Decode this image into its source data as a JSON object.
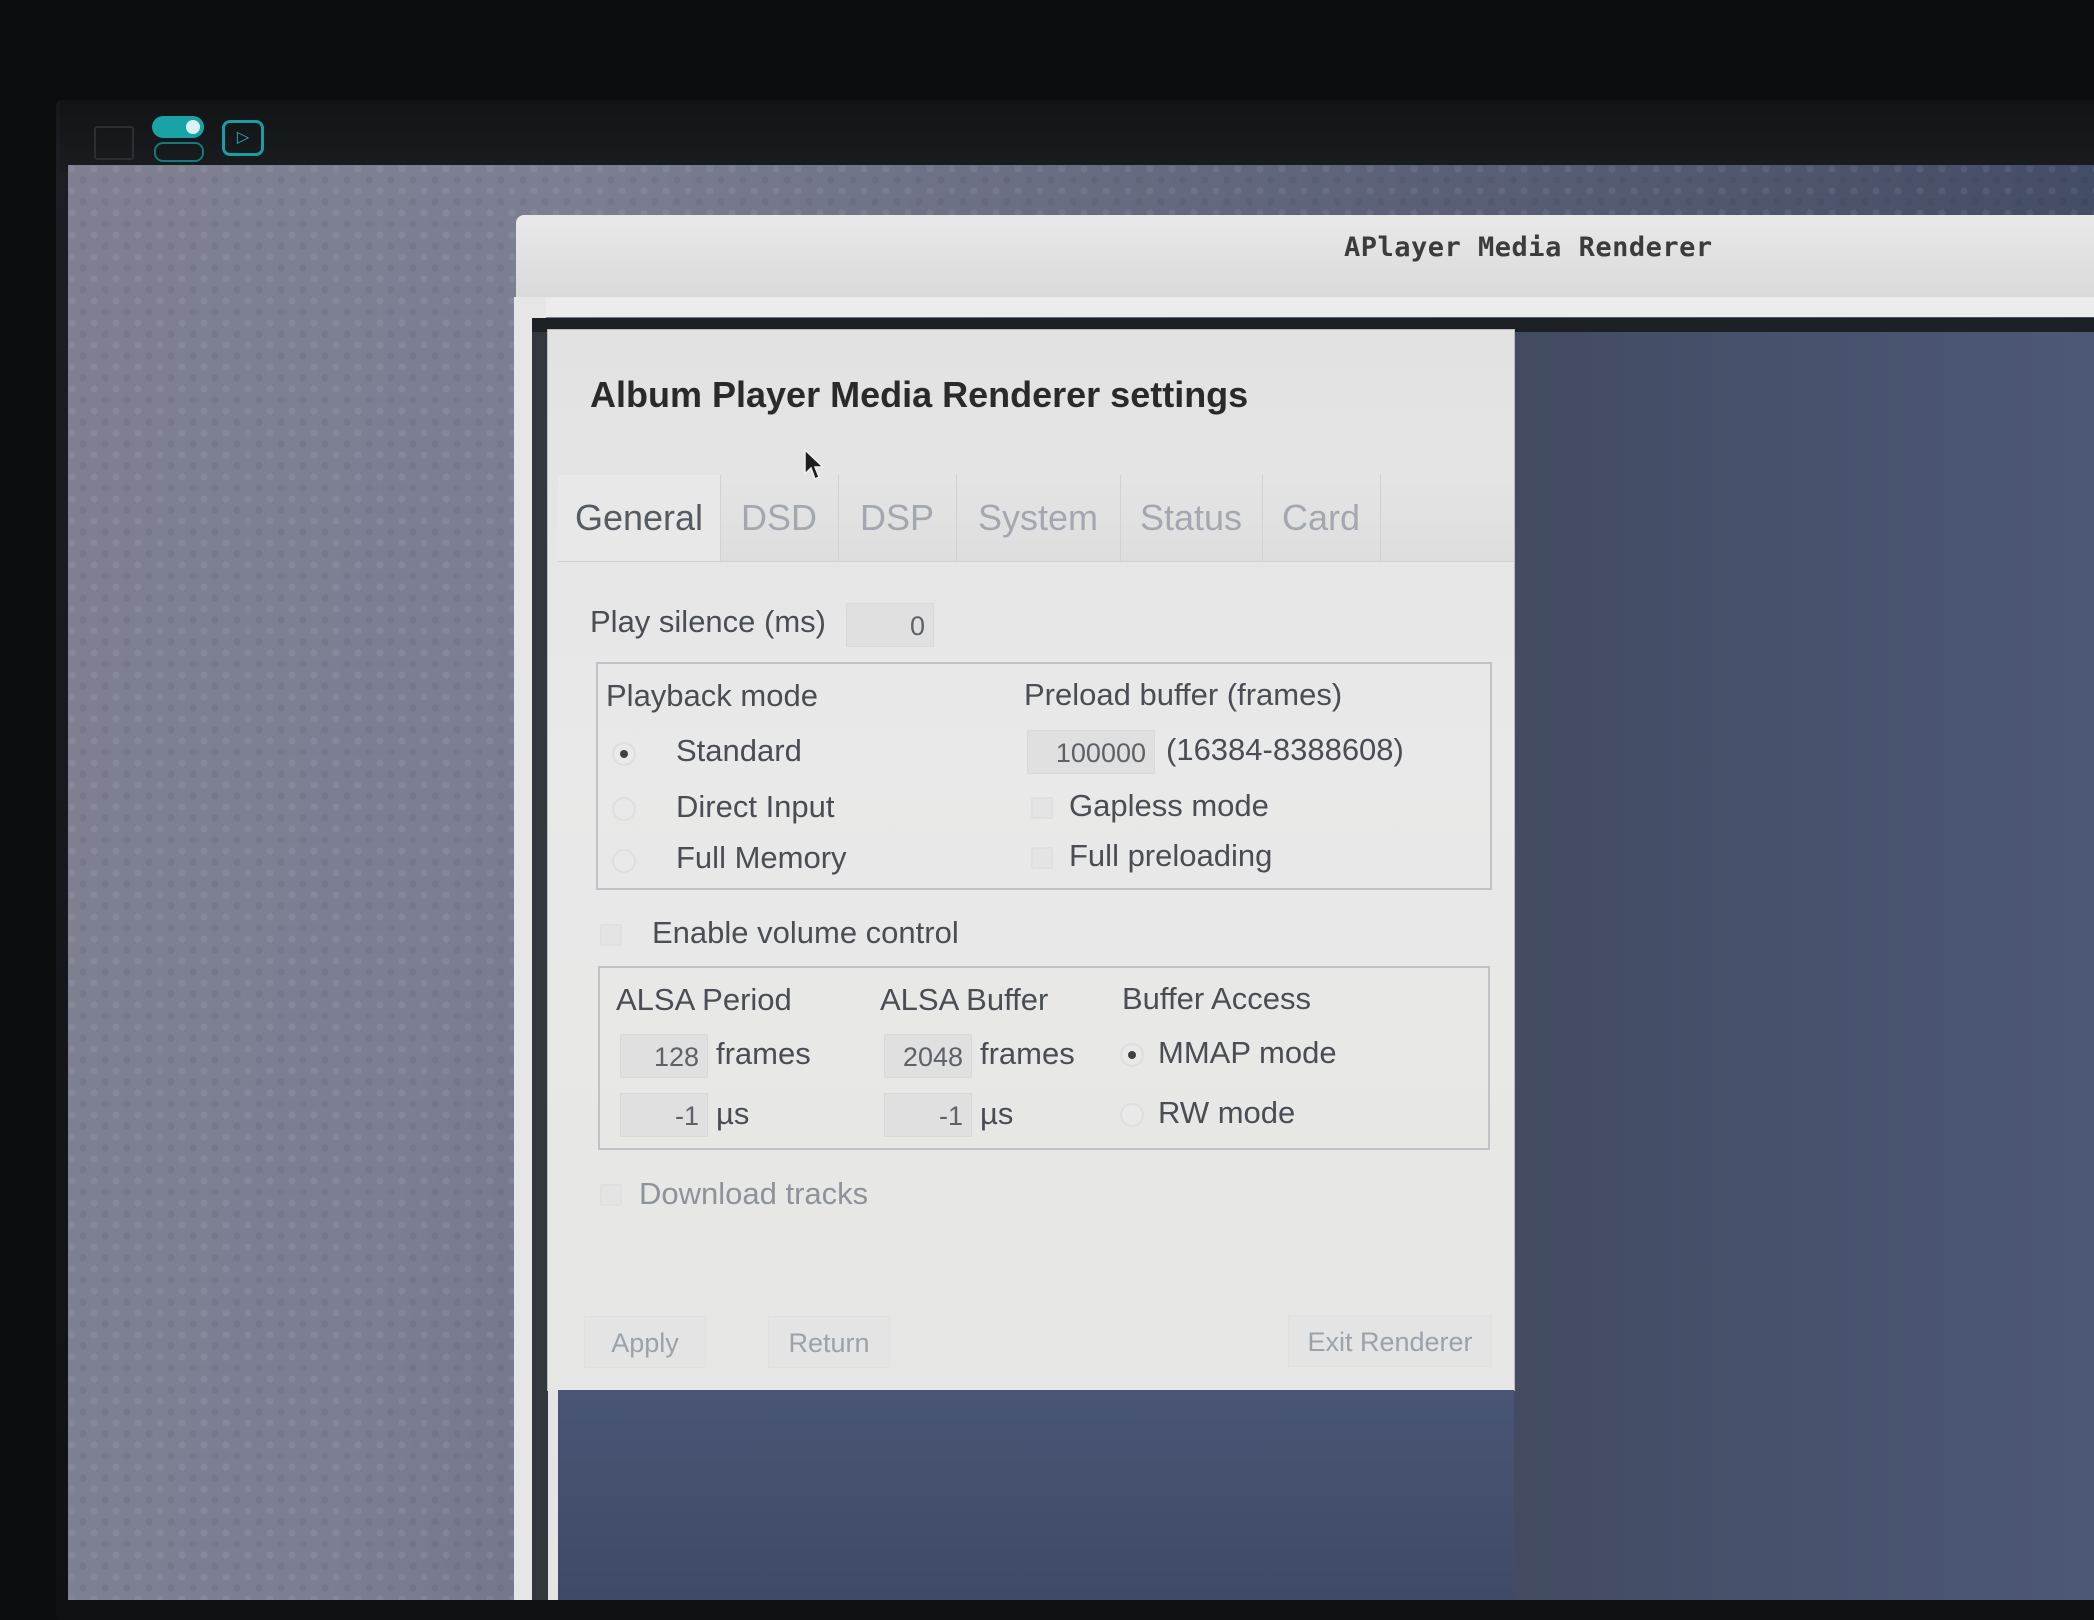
{
  "window": {
    "title": "APlayer Media Renderer"
  },
  "dialog": {
    "title": "Album Player Media Renderer settings",
    "tabs": [
      "General",
      "DSD",
      "DSP",
      "System",
      "Status",
      "Card"
    ],
    "active_tab": "General",
    "play_silence": {
      "label": "Play silence (ms)",
      "value": "0"
    },
    "playback_mode": {
      "label": "Playback mode",
      "options": [
        "Standard",
        "Direct Input",
        "Full Memory"
      ],
      "selected": "Standard"
    },
    "preload": {
      "label": "Preload buffer (frames)",
      "value": "100000",
      "range": "(16384-8388608)",
      "gapless_label": "Gapless mode",
      "gapless_checked": false,
      "full_preloading_label": "Full preloading",
      "full_preloading_checked": false
    },
    "volume_control": {
      "label": "Enable volume control",
      "checked": false
    },
    "alsa": {
      "period_label": "ALSA Period",
      "period_frames": "128",
      "period_us": "-1",
      "buffer_label": "ALSA Buffer",
      "buffer_frames": "2048",
      "buffer_us": "-1",
      "frames_unit": "frames",
      "us_unit": "µs",
      "access_label": "Buffer Access",
      "access_options": [
        "MMAP mode",
        "RW mode"
      ],
      "access_selected": "MMAP mode"
    },
    "download_tracks": {
      "label": "Download tracks",
      "checked": false
    },
    "buttons": {
      "apply": "Apply",
      "return": "Return",
      "exit": "Exit Renderer"
    }
  },
  "taskbar": {
    "icons": [
      "window-icon",
      "toggle-icon",
      "play-icon"
    ],
    "accent": "#1aa3a7"
  }
}
